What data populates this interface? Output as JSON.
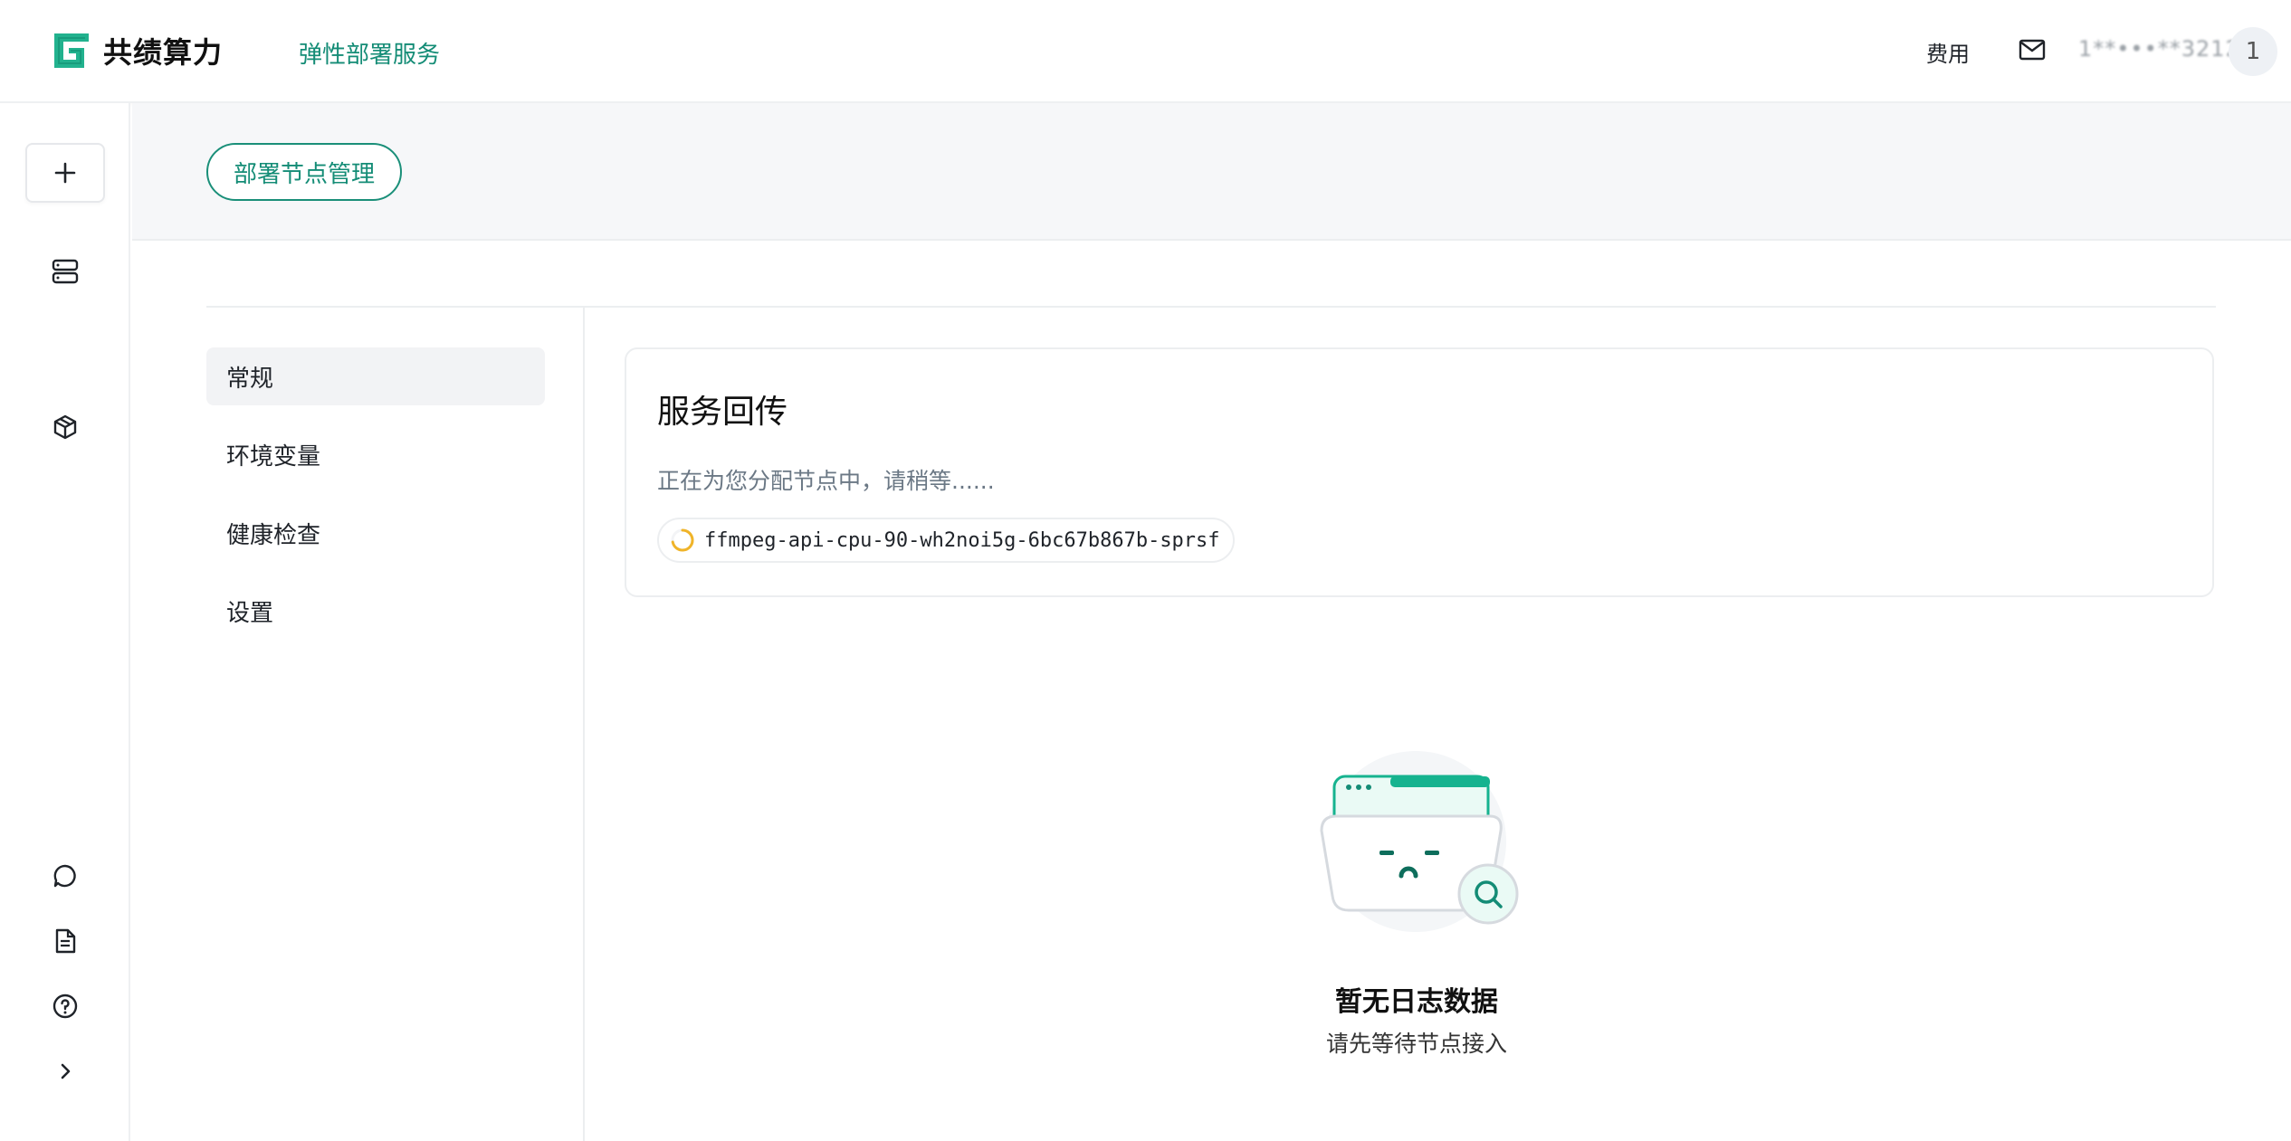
{
  "header": {
    "brand": "共绩算力",
    "service": "弹性部署服务",
    "fee_label": "费用",
    "user_id": "1**•••**3212",
    "avatar_text": "1"
  },
  "rail": {
    "icons": [
      "plus-icon",
      "server-icon",
      "package-icon",
      "chat-icon",
      "document-icon",
      "help-icon",
      "chevron-right-icon"
    ]
  },
  "page": {
    "node_manage_button": "部署节点管理"
  },
  "submenu": {
    "items": [
      {
        "label": "常规",
        "active": true
      },
      {
        "label": "环境变量",
        "active": false
      },
      {
        "label": "健康检查",
        "active": false
      },
      {
        "label": "设置",
        "active": false
      }
    ]
  },
  "card": {
    "title": "服务回传",
    "status": "正在为您分配节点中，请稍等......",
    "pod_name": "ffmpeg-api-cpu-90-wh2noi5g-6bc67b867b-sprsf"
  },
  "empty_state": {
    "title": "暂无日志数据",
    "subtitle": "请先等待节点接入"
  },
  "colors": {
    "accent": "#148c76",
    "accent_bright": "#16b38f",
    "spinner": "#f0b429"
  }
}
